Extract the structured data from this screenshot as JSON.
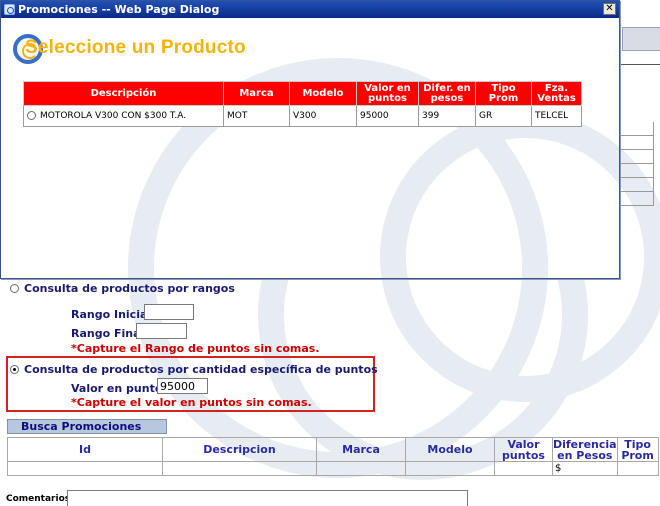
{
  "dialog": {
    "title": "Promociones -- Web Page Dialog",
    "close_glyph": "✕",
    "heading": "Seleccione un Producto",
    "table": {
      "headers": [
        "Descripción",
        "Marca",
        "Modelo",
        "Valor en puntos",
        "Difer. en pesos",
        "Tipo Prom",
        "Fza. Ventas"
      ],
      "rows": [
        {
          "descripcion": "MOTOROLA V300 CON $300 T.A.",
          "marca": "MOT",
          "modelo": "V300",
          "valor_puntos": "95000",
          "diferencia_pesos": "399",
          "tipo_prom": "GR",
          "fza_ventas": "TELCEL"
        }
      ]
    }
  },
  "page": {
    "option_rangos": {
      "label": "Consulta de productos por rangos",
      "selected": false
    },
    "rango_inicial": {
      "label": "Rango Inicial",
      "value": ""
    },
    "rango_final": {
      "label": "Rango Final",
      "value": ""
    },
    "rango_note": "*Capture el Rango de puntos sin comas.",
    "option_cantidad": {
      "label": "Consulta de productos por cantidad específica de puntos",
      "selected": true
    },
    "valor_puntos": {
      "label": "Valor en puntos",
      "value": "95000"
    },
    "valor_note": "*Capture el valor en puntos sin comas.",
    "busca_button": "Busca Promociones",
    "results_table": {
      "headers": [
        "Id",
        "Descripcion",
        "Marca",
        "Modelo",
        "Valor puntos",
        "Diferencia en Pesos",
        "Tipo Prom"
      ],
      "row": [
        "",
        "",
        "",
        "",
        "",
        "$",
        ""
      ]
    },
    "comentarios_label": "Comentarios:"
  }
}
